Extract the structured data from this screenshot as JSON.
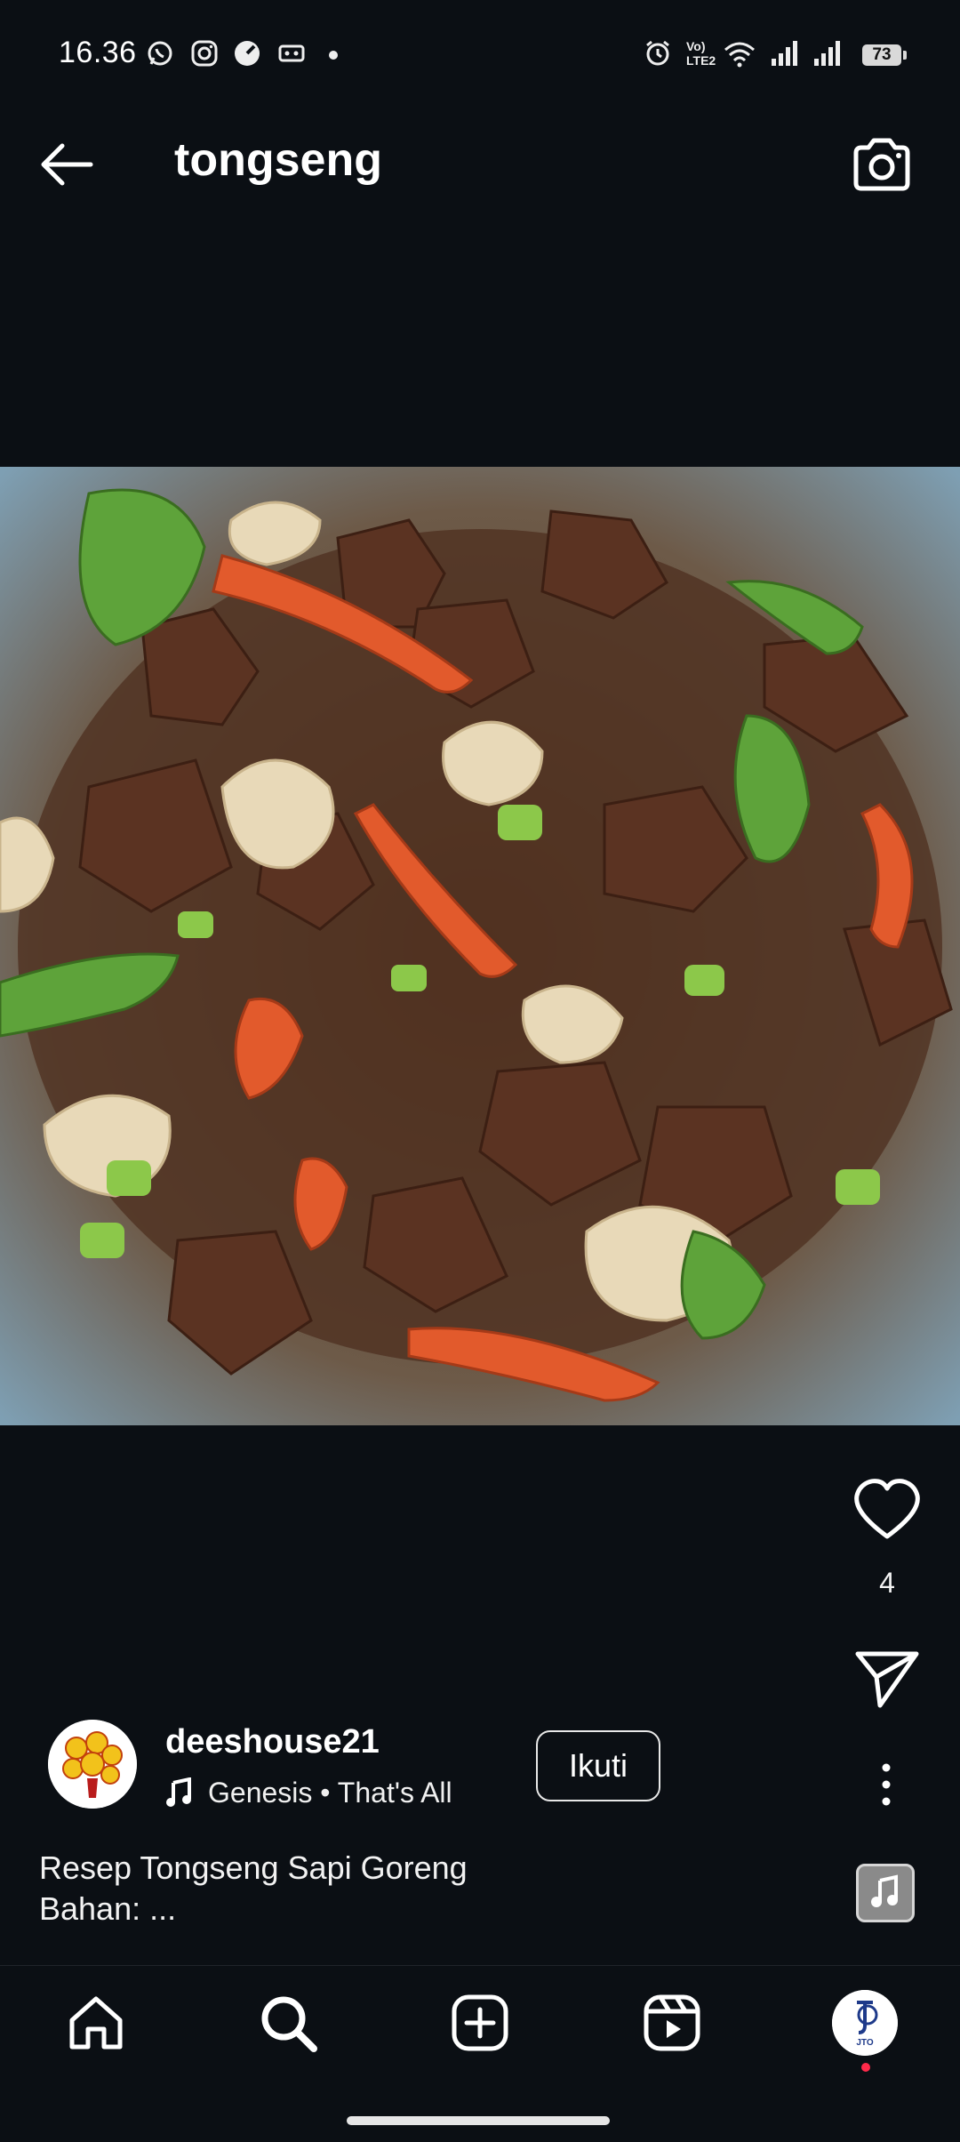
{
  "status_bar": {
    "time": "16.36",
    "network_label": "Vo) LTE2",
    "battery": "73",
    "icons": [
      "whatsapp-icon",
      "instagram-icon",
      "speed-icon",
      "cassette-icon",
      "dot-icon",
      "alarm-icon",
      "wifi-icon",
      "signal-icon",
      "signal-icon-2"
    ]
  },
  "header": {
    "title": "tongseng",
    "back_icon": "arrow-left-icon",
    "camera_icon": "camera-icon"
  },
  "post": {
    "image_description": "stir-fried beef tongseng with cabbage, tomato and chili",
    "like_count": "4",
    "author": {
      "username": "deeshouse21",
      "music": "Genesis • That's All",
      "follow_label": "Ikuti"
    },
    "caption_line1": "Resep Tongseng Sapi Goreng",
    "caption_line2": "Bahan: ..."
  },
  "nav": {
    "items": [
      "home-icon",
      "search-icon",
      "create-icon",
      "reels-icon",
      "profile-avatar"
    ],
    "profile_initials": "JTO"
  },
  "colors": {
    "background": "#0b0f14",
    "notification_dot": "#ff2a4a"
  }
}
